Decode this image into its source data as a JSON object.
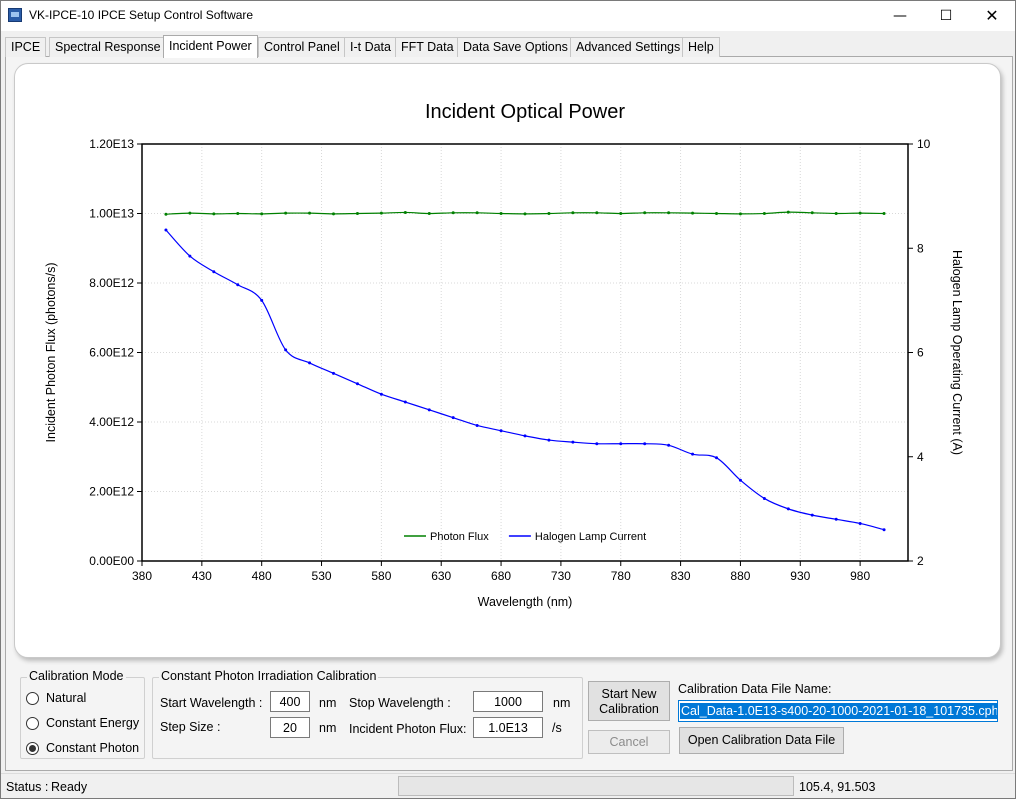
{
  "window": {
    "title": "VK-IPCE-10 IPCE Setup Control Software",
    "controls": {
      "minimize": "—",
      "maximize": "☐",
      "close": "✕"
    }
  },
  "tabs": [
    {
      "label": "IPCE"
    },
    {
      "label": "Spectral Response"
    },
    {
      "label": "Incident Power"
    },
    {
      "label": "Control Panel"
    },
    {
      "label": "I-t Data"
    },
    {
      "label": "FFT Data"
    },
    {
      "label": "Data Save Options"
    },
    {
      "label": "Advanced Settings"
    },
    {
      "label": "Help"
    }
  ],
  "active_tab": "Incident Power",
  "chart_data": {
    "type": "line",
    "title": "Incident Optical Power",
    "xlabel": "Wavelength (nm)",
    "ylabel": "Incident Photon Flux (photons/s)",
    "y2label": "Halogen Lamp Operating Current (A)",
    "xlim": [
      380,
      1020
    ],
    "ylim": [
      0,
      12000000000000
    ],
    "y2lim": [
      2,
      10
    ],
    "x_ticks": [
      "380",
      "430",
      "480",
      "530",
      "580",
      "630",
      "680",
      "730",
      "780",
      "830",
      "880",
      "930",
      "980"
    ],
    "y_ticks": [
      "0.00E00",
      "2.00E12",
      "4.00E12",
      "6.00E12",
      "8.00E12",
      "1.00E13",
      "1.20E13"
    ],
    "y2_ticks": [
      "2",
      "4",
      "6",
      "8",
      "10"
    ],
    "grid": true,
    "legend_position": "bottom-center",
    "x": [
      400,
      420,
      440,
      460,
      480,
      500,
      520,
      540,
      560,
      580,
      600,
      620,
      640,
      660,
      680,
      700,
      720,
      740,
      760,
      780,
      800,
      820,
      840,
      860,
      880,
      900,
      920,
      940,
      960,
      980,
      1000
    ],
    "series": [
      {
        "name": "Photon Flux",
        "axis": "left",
        "color": "#008000",
        "values": [
          9980000000000.0,
          10010000000000.0,
          9990000000000.0,
          10000000000000.0,
          9990000000000.0,
          10010000000000.0,
          10010000000000.0,
          9990000000000.0,
          10000000000000.0,
          10010000000000.0,
          10030000000000.0,
          10000000000000.0,
          10020000000000.0,
          10020000000000.0,
          10000000000000.0,
          9990000000000.0,
          10000000000000.0,
          10020000000000.0,
          10020000000000.0,
          10000000000000.0,
          10020000000000.0,
          10020000000000.0,
          10010000000000.0,
          10000000000000.0,
          9990000000000.0,
          10000000000000.0,
          10040000000000.0,
          10020000000000.0,
          10000000000000.0,
          10010000000000.0,
          10000000000000.0
        ]
      },
      {
        "name": "Halogen Lamp Current",
        "axis": "right",
        "color": "#0000ff",
        "values": [
          8.35,
          7.85,
          7.55,
          7.3,
          7.0,
          6.05,
          5.8,
          5.6,
          5.4,
          5.2,
          5.05,
          4.9,
          4.75,
          4.6,
          4.5,
          4.4,
          4.32,
          4.28,
          4.25,
          4.25,
          4.25,
          4.22,
          4.05,
          3.98,
          3.55,
          3.2,
          3.0,
          2.88,
          2.8,
          2.72,
          2.6
        ]
      }
    ]
  },
  "calibration_mode": {
    "title": "Calibration Mode",
    "options": [
      {
        "label": "Natural",
        "checked": false
      },
      {
        "label": "Constant Energy",
        "checked": false
      },
      {
        "label": "Constant Photon",
        "checked": true
      }
    ]
  },
  "constant_photon": {
    "title": "Constant Photon Irradiation Calibration",
    "start_wavelength_label": "Start Wavelength :",
    "start_wavelength_value": "400",
    "start_unit": "nm",
    "stop_wavelength_label": "Stop Wavelength :",
    "stop_wavelength_value": "1000",
    "stop_unit": "nm",
    "step_size_label": "Step Size :",
    "step_size_value": "20",
    "step_unit": "nm",
    "flux_label": "Incident Photon Flux:",
    "flux_value": "1.0E13",
    "flux_unit": "/s"
  },
  "buttons": {
    "start_new_calibration_line1": "Start New",
    "start_new_calibration_line2": "Calibration",
    "cancel": "Cancel",
    "open_calibration_file": "Open Calibration Data File"
  },
  "calibration_file": {
    "label": "Calibration Data File Name:",
    "value": "Cal_Data-1.0E13-s400-20-1000-2021-01-18_101735.cph"
  },
  "status": {
    "label": "Status :",
    "value": "Ready",
    "progress": 0,
    "coordinates": "105.4, 91.503"
  }
}
